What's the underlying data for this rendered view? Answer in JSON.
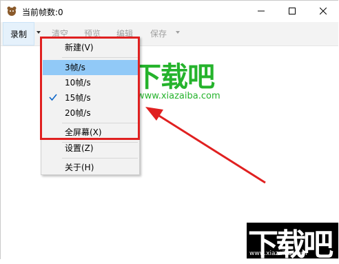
{
  "window": {
    "title": "当前帧数:0"
  },
  "toolbar": {
    "record": "录制",
    "clear": "清空",
    "preview": "预览",
    "edit": "编辑",
    "save": "保存"
  },
  "menu": {
    "new": "新建(V)",
    "fps_3": "3帧/s",
    "fps_10": "10帧/s",
    "fps_15": "15帧/s",
    "fps_20": "20帧/s",
    "fullscreen": "全屏幕(X)",
    "settings": "设置(Z)",
    "about": "关于(H)",
    "selected": "15帧/s",
    "hovered": "3帧/s"
  },
  "watermark": {
    "logo_text": "下载吧",
    "url": "www.xiazaiba.com"
  },
  "corner_logo": {
    "logo_text": "下载吧",
    "url": "www.xiazaiba.com"
  },
  "colors": {
    "annotation_red": "#e02020",
    "hover_blue": "#91c9f7",
    "watermark_green": "#25b32c"
  }
}
